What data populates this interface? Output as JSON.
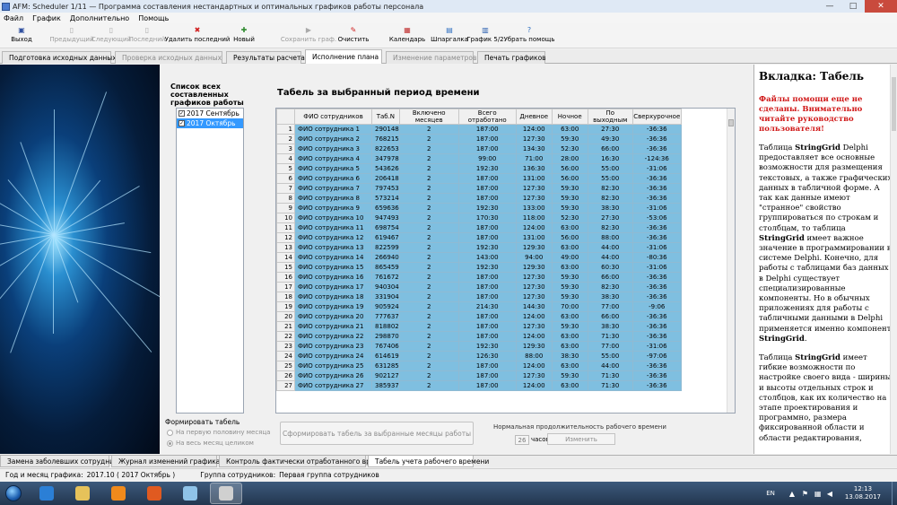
{
  "window": {
    "title": "AFM: Scheduler 1/11 — Программа составления  нестандартных и оптимальных графиков работы персонала",
    "minimize": "—",
    "maximize": "□",
    "close": "✕"
  },
  "menu": [
    "Файл",
    "График",
    "Дополнительно",
    "Помощь"
  ],
  "toolbar": [
    {
      "label": "Выход",
      "icon": "exit-icon",
      "disabled": false,
      "color": "#3050a0"
    },
    {
      "label": "Предыдущий",
      "icon": "page-icon",
      "disabled": true,
      "color": "#aaaaaa"
    },
    {
      "label": "Следующий",
      "icon": "page-icon",
      "disabled": true,
      "color": "#aaaaaa"
    },
    {
      "label": "Последний",
      "icon": "page-icon",
      "disabled": true,
      "color": "#aaaaaa"
    },
    {
      "label": "Удалить последний",
      "icon": "delete-icon",
      "disabled": false,
      "color": "#d02020"
    },
    {
      "label": "Новый",
      "icon": "new-icon",
      "disabled": false,
      "color": "#2e8a2e"
    },
    {
      "label": "Сохранить граф.",
      "icon": "play-icon",
      "disabled": true,
      "color": "#aaaaaa"
    },
    {
      "label": "Очистить",
      "icon": "clear-icon",
      "disabled": false,
      "color": "#d02020"
    },
    {
      "label": "Календарь",
      "icon": "calendar-icon",
      "disabled": false,
      "color": "#c03030"
    },
    {
      "label": "Шпаргалка",
      "icon": "cheatsheet-icon",
      "disabled": false,
      "color": "#3070c0"
    },
    {
      "label": "График 5/2",
      "icon": "chart-icon",
      "disabled": false,
      "color": "#2a60b0"
    },
    {
      "label": "Убрать помощь",
      "icon": "help-icon",
      "disabled": false,
      "color": "#3070c0"
    }
  ],
  "tabs_top": [
    {
      "label": "Подготовка исходных данных",
      "disabled": false,
      "active": false,
      "color": "#3a8a3a"
    },
    {
      "label": "Проверка исходных данных",
      "disabled": true,
      "active": false,
      "color": "#9a9a9a"
    },
    {
      "label": "Результаты расчета",
      "disabled": false,
      "active": false,
      "color": "#6c6c6c"
    },
    {
      "label": "Исполнение плана",
      "disabled": false,
      "active": true,
      "color": "#3070c0"
    },
    {
      "label": "Изменение параметров",
      "disabled": true,
      "active": false,
      "color": "#9a9a9a"
    },
    {
      "label": "Печать графиков",
      "disabled": false,
      "active": false,
      "color": "#6c6c6c"
    }
  ],
  "left_panel": {
    "list_label": "Список всех составленных графиков работы",
    "months": [
      {
        "label": "2017  Сентябрь",
        "checked": true,
        "selected": false
      },
      {
        "label": "2017  Октябрь",
        "checked": true,
        "selected": true
      }
    ],
    "form_label": "Формировать табель",
    "radio_first_half": "На первую половину месяца",
    "radio_whole_month": "На весь месяц целиком"
  },
  "grid": {
    "title": "Табель за выбранный период времени",
    "columns": [
      "",
      "ФИО сотрудников",
      "Таб.N",
      "Включено месяцев",
      "Всего отработано",
      "Дневное",
      "Ночное",
      "По выходным",
      "Сверхурочное"
    ],
    "rows": [
      [
        "1",
        "ФИО сотрудника 1",
        "290148",
        "2",
        "187:00",
        "124:00",
        "63:00",
        "27:30",
        "-36:36"
      ],
      [
        "2",
        "ФИО сотрудника 2",
        "768215",
        "2",
        "187:00",
        "127:30",
        "59:30",
        "49:30",
        "-36:36"
      ],
      [
        "3",
        "ФИО сотрудника 3",
        "822653",
        "2",
        "187:00",
        "134:30",
        "52:30",
        "66:00",
        "-36:36"
      ],
      [
        "4",
        "ФИО сотрудника 4",
        "347978",
        "2",
        "99:00",
        "71:00",
        "28:00",
        "16:30",
        "-124:36"
      ],
      [
        "5",
        "ФИО сотрудника 5",
        "543626",
        "2",
        "192:30",
        "136:30",
        "56:00",
        "55:00",
        "-31:06"
      ],
      [
        "6",
        "ФИО сотрудника 6",
        "206418",
        "2",
        "187:00",
        "131:00",
        "56:00",
        "55:00",
        "-36:36"
      ],
      [
        "7",
        "ФИО сотрудника 7",
        "797453",
        "2",
        "187:00",
        "127:30",
        "59:30",
        "82:30",
        "-36:36"
      ],
      [
        "8",
        "ФИО сотрудника 8",
        "573214",
        "2",
        "187:00",
        "127:30",
        "59:30",
        "82:30",
        "-36:36"
      ],
      [
        "9",
        "ФИО сотрудника 9",
        "659636",
        "2",
        "192:30",
        "133:00",
        "59:30",
        "38:30",
        "-31:06"
      ],
      [
        "10",
        "ФИО сотрудника 10",
        "947493",
        "2",
        "170:30",
        "118:00",
        "52:30",
        "27:30",
        "-53:06"
      ],
      [
        "11",
        "ФИО сотрудника 11",
        "698754",
        "2",
        "187:00",
        "124:00",
        "63:00",
        "82:30",
        "-36:36"
      ],
      [
        "12",
        "ФИО сотрудника 12",
        "619467",
        "2",
        "187:00",
        "131:00",
        "56:00",
        "88:00",
        "-36:36"
      ],
      [
        "13",
        "ФИО сотрудника 13",
        "822599",
        "2",
        "192:30",
        "129:30",
        "63:00",
        "44:00",
        "-31:06"
      ],
      [
        "14",
        "ФИО сотрудника 14",
        "266940",
        "2",
        "143:00",
        "94:00",
        "49:00",
        "44:00",
        "-80:36"
      ],
      [
        "15",
        "ФИО сотрудника 15",
        "865459",
        "2",
        "192:30",
        "129:30",
        "63:00",
        "60:30",
        "-31:06"
      ],
      [
        "16",
        "ФИО сотрудника 16",
        "761672",
        "2",
        "187:00",
        "127:30",
        "59:30",
        "66:00",
        "-36:36"
      ],
      [
        "17",
        "ФИО сотрудника 17",
        "940304",
        "2",
        "187:00",
        "127:30",
        "59:30",
        "82:30",
        "-36:36"
      ],
      [
        "18",
        "ФИО сотрудника 18",
        "331904",
        "2",
        "187:00",
        "127:30",
        "59:30",
        "38:30",
        "-36:36"
      ],
      [
        "19",
        "ФИО сотрудника 19",
        "905924",
        "2",
        "214:30",
        "144:30",
        "70:00",
        "77:00",
        "-9:06"
      ],
      [
        "20",
        "ФИО сотрудника 20",
        "777637",
        "2",
        "187:00",
        "124:00",
        "63:00",
        "66:00",
        "-36:36"
      ],
      [
        "21",
        "ФИО сотрудника 21",
        "818802",
        "2",
        "187:00",
        "127:30",
        "59:30",
        "38:30",
        "-36:36"
      ],
      [
        "22",
        "ФИО сотрудника 22",
        "298870",
        "2",
        "187:00",
        "124:00",
        "63:00",
        "71:30",
        "-36:36"
      ],
      [
        "23",
        "ФИО сотрудника 23",
        "767406",
        "2",
        "192:30",
        "129:30",
        "63:00",
        "77:00",
        "-31:06"
      ],
      [
        "24",
        "ФИО сотрудника 24",
        "614619",
        "2",
        "126:30",
        "88:00",
        "38:30",
        "55:00",
        "-97:06"
      ],
      [
        "25",
        "ФИО сотрудника 25",
        "631285",
        "2",
        "187:00",
        "124:00",
        "63:00",
        "44:00",
        "-36:36"
      ],
      [
        "26",
        "ФИО сотрудника 26",
        "902127",
        "2",
        "187:00",
        "127:30",
        "59:30",
        "71:30",
        "-36:36"
      ],
      [
        "27",
        "ФИО сотрудника 27",
        "385937",
        "2",
        "187:00",
        "124:00",
        "63:00",
        "71:30",
        "-36:36"
      ]
    ]
  },
  "bottom_controls": {
    "generate_button": "Сформировать табель за выбранные месяцы работы",
    "norm_label": "Нормальная продолжительность рабочего времени",
    "hours_value": "26",
    "hours_unit": "часов",
    "change_button": "Изменить"
  },
  "help": {
    "heading": "Вкладка: Табель",
    "warning": "Файлы помощи еще не сделаны. Внимательно читайте руководство пользователя!",
    "p1_html": "Таблица <b>StringGrid</b> Delphi предоставляет все основные возможности для размещения текстовых, а также графических данных в табличной форме. А так как данные имеют \"странное\" свойство группироваться по строкам и столбцам, то таблица <b>StringGrid</b> имеет важное значение в программировании в системе Delphi. Конечно, для работы с таблицами баз данных в Delphi существует специализированные компоненты. Но в обычных приложениях для работы с табличными данными в Delphi применяется именно компонент <b>StringGrid</b>.",
    "p2_html": "Таблица <b>StringGrid</b> имеет гибкие возможности по настройке своего вида - ширины и высоты отдельных строк и столбцов, как их количество на этапе проектирования и программно, размера фиксированной области и области редактирования,"
  },
  "tabs_bottom": [
    {
      "label": "Замена заболевших сотрудников",
      "active": false,
      "color": "#d02020"
    },
    {
      "label": "Журнал изменений графика",
      "active": false,
      "color": "#6c6c6c"
    },
    {
      "label": "Контроль фактически отработанного времени",
      "active": false,
      "color": "#e0a020"
    },
    {
      "label": "Табель учета рабочего времени",
      "active": true,
      "color": "#e0a020"
    }
  ],
  "status": {
    "year_month_label": "Год и месяц графика:",
    "year_month_value": "2017.10  ( 2017  Октябрь )",
    "group_label": "Группа сотрудников:",
    "group_value": "Первая группа сотрудников"
  },
  "taskbar": {
    "apps": [
      {
        "icon": "ie-icon",
        "color": "#2b7fd6",
        "active": false
      },
      {
        "icon": "folder-icon",
        "color": "#e6c25a",
        "active": false
      },
      {
        "icon": "media-player-icon",
        "color": "#f08a1c",
        "active": false
      },
      {
        "icon": "firefox-icon",
        "color": "#e05a20",
        "active": false
      },
      {
        "icon": "afm-app-icon",
        "color": "#8fc3e8",
        "active": false
      },
      {
        "icon": "scheduler-icon",
        "color": "#d0d0d0",
        "active": true
      }
    ],
    "lang": "EN",
    "time": "12:13",
    "date": "13.08.2017"
  }
}
